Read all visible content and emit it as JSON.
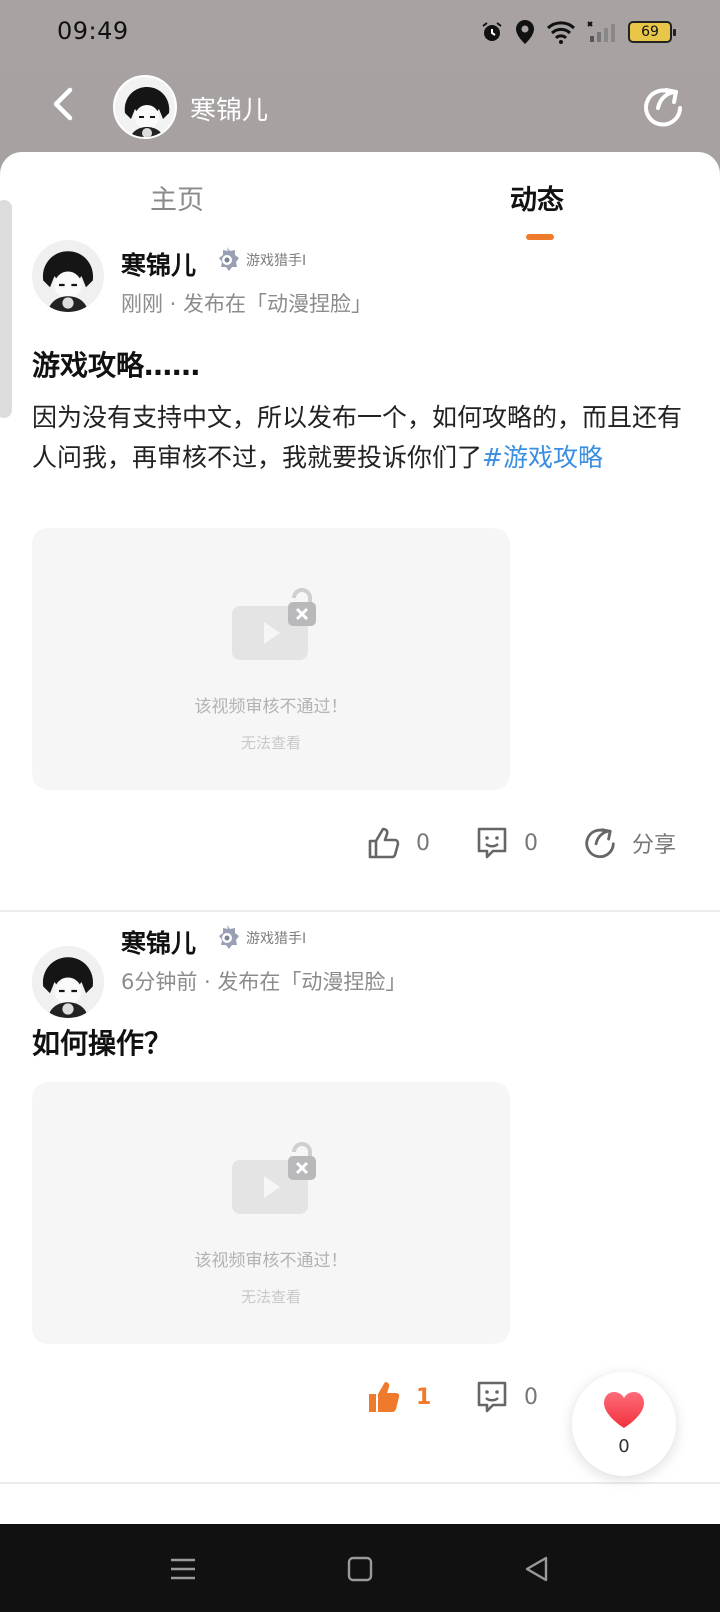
{
  "status_bar": {
    "time": "09:49",
    "battery": "69"
  },
  "header": {
    "name": "寒锦儿"
  },
  "tabs": [
    {
      "label": "主页"
    },
    {
      "label": "动态"
    }
  ],
  "posts": [
    {
      "author": "寒锦儿",
      "badge": "游戏猎手I",
      "meta": "刚刚 · 发布在「动漫捏脸」",
      "title": "游戏攻略……",
      "body": "因为没有支持中文，所以发布一个，如何攻略的，而且还有人问我，再审核不过，我就要投诉你们了",
      "hashtag": "#游戏攻略",
      "video": {
        "message": "该视频审核不通过！",
        "sub": "无法查看"
      },
      "likes": "0",
      "comments": "0",
      "share": "分享"
    },
    {
      "author": "寒锦儿",
      "badge": "游戏猎手I",
      "meta": "6分钟前 · 发布在「动漫捏脸」",
      "title": "如何操作？",
      "video": {
        "message": "该视频审核不通过！",
        "sub": "无法查看"
      },
      "likes": "1",
      "comments": "0"
    }
  ],
  "floating_like": {
    "count": "0"
  },
  "colors": {
    "accent": "#f07a2c",
    "hashtag": "#3a8fe0",
    "heart": "#ff4757"
  }
}
